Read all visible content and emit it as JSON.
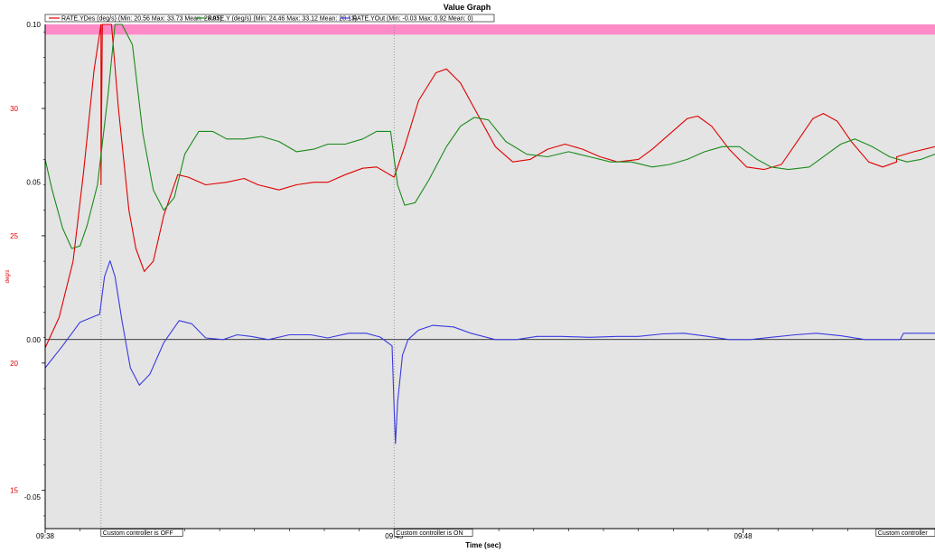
{
  "window": {
    "title": "Value Graph"
  },
  "colors": {
    "background": "#e4e4e4",
    "limit_band": "#ff8ac8",
    "series_ydes": "#e00000",
    "series_y": "#1a8a1a",
    "series_yout": "#3a3ae0",
    "left_axis": "#e00000"
  },
  "chart_data": {
    "type": "line",
    "title": "Value Graph",
    "xlabel": "Time (sec)",
    "ylabel_left": "deg/s",
    "x_tick_labels": [
      "09:38",
      "09:43",
      "09:48"
    ],
    "x_range": [
      0,
      12.75
    ],
    "x_tick_positions": [
      0,
      5,
      10
    ],
    "y_left_ticks": [
      15,
      20,
      25,
      30
    ],
    "y_left_range": [
      13.5,
      33.3
    ],
    "y_right_ticks": [
      -0.05,
      0.0,
      0.05,
      0.1
    ],
    "y_right_range": [
      -0.06,
      0.1
    ],
    "grid": false,
    "legend": [
      {
        "name": "RATE.YDes (deg/s) (Min: 20.56 Max: 33.73 Mean: 28.05)",
        "color": "#e00000"
      },
      {
        "name": "RATE.Y (deg/s) (Min: 24.46 Max: 33.12 Mean: 28.13)",
        "color": "#1a8a1a"
      },
      {
        "name": "RATE.YOut (Min: -0.03 Max: 0.92 Mean: 0)",
        "color": "#3a3ae0"
      }
    ],
    "limit_band": {
      "from": 32.9,
      "to": 33.3,
      "color": "#ff8ac8"
    },
    "annotations": [
      {
        "x": 0.8,
        "text": "Custom controller is OFF"
      },
      {
        "x": 5.0,
        "text": "Custom controller is ON"
      },
      {
        "x": 12.4,
        "text": "Custom controller"
      }
    ],
    "series": [
      {
        "name": "RATE.YDes",
        "axis": "left",
        "color": "#e00000",
        "points": [
          [
            0,
            20.6
          ],
          [
            0.2,
            21.8
          ],
          [
            0.4,
            24.0
          ],
          [
            0.55,
            27.5
          ],
          [
            0.7,
            31.5
          ],
          [
            0.8,
            33.3
          ],
          [
            0.8,
            27.0
          ],
          [
            0.82,
            33.3
          ],
          [
            0.95,
            33.3
          ],
          [
            1.05,
            30.0
          ],
          [
            1.2,
            26.0
          ],
          [
            1.3,
            24.5
          ],
          [
            1.42,
            23.6
          ],
          [
            1.55,
            24.0
          ],
          [
            1.7,
            25.8
          ],
          [
            1.9,
            27.4
          ],
          [
            2.05,
            27.3
          ],
          [
            2.3,
            27.0
          ],
          [
            2.6,
            27.1
          ],
          [
            2.85,
            27.25
          ],
          [
            3.05,
            27.0
          ],
          [
            3.35,
            26.8
          ],
          [
            3.6,
            27.0
          ],
          [
            3.85,
            27.1
          ],
          [
            4.05,
            27.1
          ],
          [
            4.3,
            27.4
          ],
          [
            4.55,
            27.65
          ],
          [
            4.75,
            27.7
          ],
          [
            5.0,
            27.3
          ],
          [
            5.15,
            28.5
          ],
          [
            5.35,
            30.3
          ],
          [
            5.6,
            31.4
          ],
          [
            5.75,
            31.55
          ],
          [
            5.95,
            31.0
          ],
          [
            6.15,
            30.0
          ],
          [
            6.45,
            28.5
          ],
          [
            6.7,
            27.9
          ],
          [
            6.95,
            28.0
          ],
          [
            7.2,
            28.4
          ],
          [
            7.45,
            28.6
          ],
          [
            7.7,
            28.4
          ],
          [
            7.95,
            28.1
          ],
          [
            8.2,
            27.9
          ],
          [
            8.5,
            28.0
          ],
          [
            8.7,
            28.4
          ],
          [
            8.95,
            29.0
          ],
          [
            9.2,
            29.6
          ],
          [
            9.35,
            29.7
          ],
          [
            9.55,
            29.3
          ],
          [
            9.8,
            28.4
          ],
          [
            10.05,
            27.7
          ],
          [
            10.3,
            27.6
          ],
          [
            10.55,
            27.8
          ],
          [
            10.8,
            28.8
          ],
          [
            11.0,
            29.6
          ],
          [
            11.15,
            29.8
          ],
          [
            11.35,
            29.5
          ],
          [
            11.55,
            28.7
          ],
          [
            11.8,
            27.9
          ],
          [
            12.0,
            27.7
          ],
          [
            12.2,
            27.9
          ],
          [
            12.2,
            28.1
          ],
          [
            12.45,
            28.3
          ],
          [
            12.75,
            28.5
          ]
        ]
      },
      {
        "name": "RATE.Y",
        "axis": "left",
        "color": "#1a8a1a",
        "points": [
          [
            0,
            28.0
          ],
          [
            0.1,
            26.8
          ],
          [
            0.25,
            25.3
          ],
          [
            0.38,
            24.5
          ],
          [
            0.5,
            24.6
          ],
          [
            0.6,
            25.4
          ],
          [
            0.75,
            27.0
          ],
          [
            0.9,
            30.5
          ],
          [
            1.0,
            33.3
          ],
          [
            1.1,
            33.3
          ],
          [
            1.25,
            32.5
          ],
          [
            1.4,
            29.0
          ],
          [
            1.55,
            26.8
          ],
          [
            1.7,
            26.0
          ],
          [
            1.85,
            26.5
          ],
          [
            2.0,
            28.2
          ],
          [
            2.2,
            29.1
          ],
          [
            2.4,
            29.1
          ],
          [
            2.6,
            28.8
          ],
          [
            2.85,
            28.8
          ],
          [
            3.1,
            28.9
          ],
          [
            3.35,
            28.7
          ],
          [
            3.6,
            28.3
          ],
          [
            3.85,
            28.4
          ],
          [
            4.05,
            28.6
          ],
          [
            4.3,
            28.6
          ],
          [
            4.55,
            28.8
          ],
          [
            4.75,
            29.1
          ],
          [
            4.95,
            29.1
          ],
          [
            5.05,
            27.0
          ],
          [
            5.15,
            26.2
          ],
          [
            5.3,
            26.3
          ],
          [
            5.5,
            27.2
          ],
          [
            5.75,
            28.5
          ],
          [
            5.95,
            29.3
          ],
          [
            6.15,
            29.65
          ],
          [
            6.35,
            29.55
          ],
          [
            6.6,
            28.7
          ],
          [
            6.9,
            28.2
          ],
          [
            7.2,
            28.1
          ],
          [
            7.5,
            28.3
          ],
          [
            7.8,
            28.1
          ],
          [
            8.1,
            27.9
          ],
          [
            8.4,
            27.9
          ],
          [
            8.7,
            27.7
          ],
          [
            8.95,
            27.8
          ],
          [
            9.2,
            28.0
          ],
          [
            9.45,
            28.3
          ],
          [
            9.7,
            28.5
          ],
          [
            9.95,
            28.5
          ],
          [
            10.2,
            28.0
          ],
          [
            10.4,
            27.7
          ],
          [
            10.65,
            27.6
          ],
          [
            10.95,
            27.7
          ],
          [
            11.2,
            28.2
          ],
          [
            11.4,
            28.6
          ],
          [
            11.6,
            28.8
          ],
          [
            11.85,
            28.5
          ],
          [
            12.1,
            28.1
          ],
          [
            12.35,
            27.9
          ],
          [
            12.55,
            28.0
          ],
          [
            12.75,
            28.2
          ]
        ]
      },
      {
        "name": "RATE.YOut",
        "axis": "right",
        "color": "#3a3ae0",
        "points": [
          [
            0,
            -0.009
          ],
          [
            0.25,
            -0.002
          ],
          [
            0.5,
            0.0055
          ],
          [
            0.72,
            0.0075
          ],
          [
            0.78,
            0.008
          ],
          [
            0.85,
            0.02
          ],
          [
            0.93,
            0.025
          ],
          [
            1.0,
            0.02
          ],
          [
            1.1,
            0.006
          ],
          [
            1.22,
            -0.009
          ],
          [
            1.35,
            -0.0145
          ],
          [
            1.5,
            -0.011
          ],
          [
            1.7,
            -0.001
          ],
          [
            1.92,
            0.006
          ],
          [
            2.1,
            0.005
          ],
          [
            2.3,
            0.0005
          ],
          [
            2.55,
            0.0
          ],
          [
            2.75,
            0.0015
          ],
          [
            2.95,
            0.001
          ],
          [
            3.2,
            0.0
          ],
          [
            3.5,
            0.0015
          ],
          [
            3.8,
            0.0015
          ],
          [
            4.05,
            0.0005
          ],
          [
            4.35,
            0.002
          ],
          [
            4.6,
            0.002
          ],
          [
            4.8,
            0.0008
          ],
          [
            4.97,
            -0.002
          ],
          [
            5.0,
            -0.022
          ],
          [
            5.02,
            -0.033
          ],
          [
            5.05,
            -0.02
          ],
          [
            5.12,
            -0.005
          ],
          [
            5.2,
            0.0
          ],
          [
            5.35,
            0.003
          ],
          [
            5.55,
            0.0045
          ],
          [
            5.85,
            0.004
          ],
          [
            6.1,
            0.002
          ],
          [
            6.45,
            0.0
          ],
          [
            6.75,
            0.0
          ],
          [
            7.05,
            0.001
          ],
          [
            7.4,
            0.001
          ],
          [
            7.8,
            0.0007
          ],
          [
            8.2,
            0.001
          ],
          [
            8.5,
            0.001
          ],
          [
            8.85,
            0.0018
          ],
          [
            9.15,
            0.002
          ],
          [
            9.5,
            0.001
          ],
          [
            9.8,
            0.0
          ],
          [
            10.1,
            0.0
          ],
          [
            10.4,
            0.0007
          ],
          [
            10.75,
            0.0015
          ],
          [
            11.05,
            0.002
          ],
          [
            11.4,
            0.0012
          ],
          [
            11.75,
            0.0
          ],
          [
            12.05,
            0.0
          ],
          [
            12.25,
            0.0
          ],
          [
            12.3,
            0.002
          ],
          [
            12.55,
            0.002
          ],
          [
            12.75,
            0.002
          ]
        ]
      }
    ]
  }
}
